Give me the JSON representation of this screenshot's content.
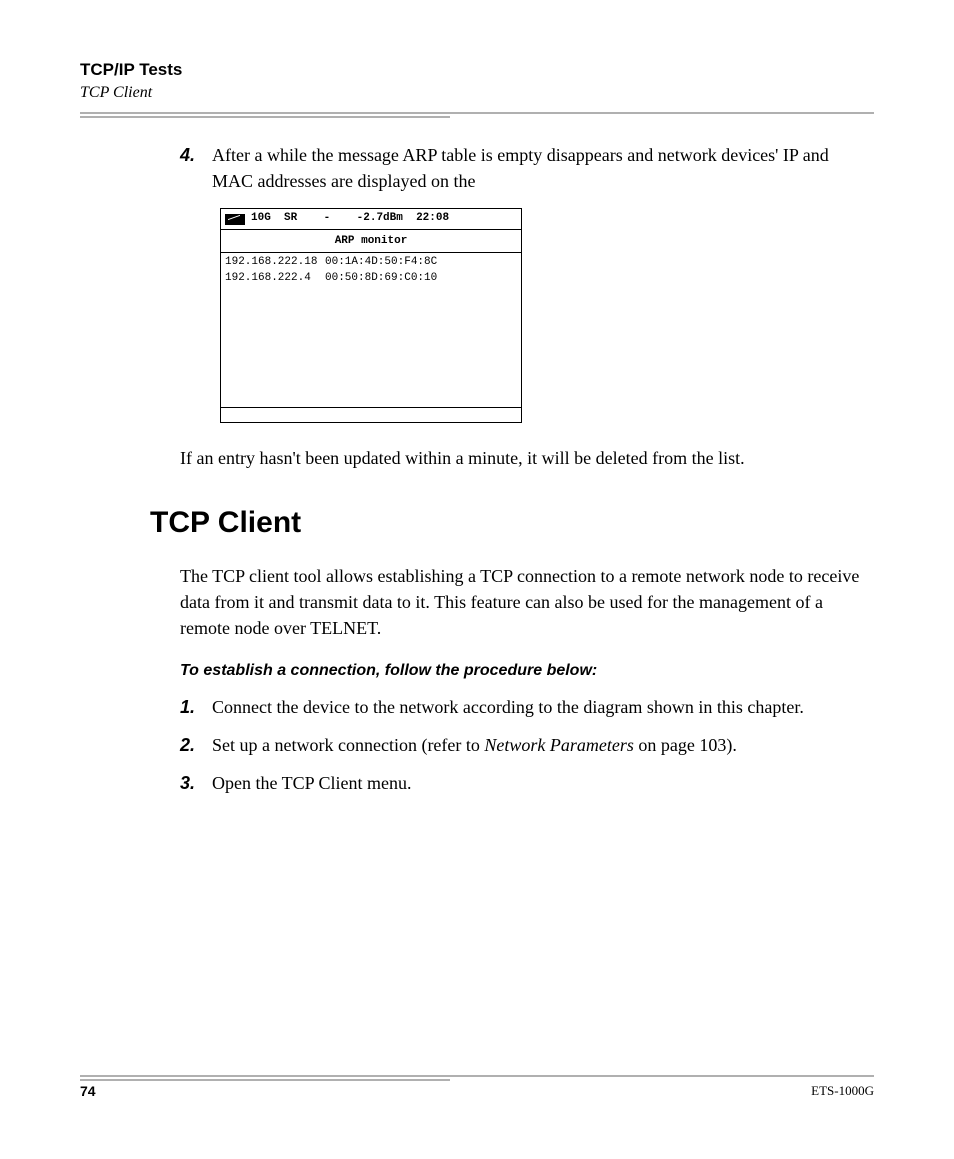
{
  "header": {
    "chapter": "TCP/IP Tests",
    "section": "TCP Client"
  },
  "step4": {
    "num": "4.",
    "text": "After a while the message ARP table is empty disappears and network devices' IP and MAC addresses are displayed on the"
  },
  "screenshot": {
    "top": {
      "speed": "10G",
      "mode": "SR",
      "dash": "-",
      "dbm": "-2.7dBm",
      "time": "22:08"
    },
    "title": "ARP monitor",
    "rows": [
      {
        "ip": "192.168.222.18",
        "mac": "00:1A:4D:50:F4:8C"
      },
      {
        "ip": "192.168.222.4",
        "mac": "00:50:8D:69:C0:10"
      }
    ]
  },
  "after_screenshot_para": "If an entry hasn't been updated within a minute, it will be deleted from the list.",
  "heading2": "TCP Client",
  "tcp_intro": "The TCP client tool allows establishing a TCP connection to a remote network node to receive data from it and transmit data to it. This feature can also be used for the management of a remote node over TELNET.",
  "procedure_label": "To establish a connection, follow the procedure below:",
  "steps": [
    {
      "num": "1.",
      "text": "Connect the device to the network according to the diagram shown in this chapter."
    },
    {
      "num": "2.",
      "text_pre": "Set up a network connection (refer to ",
      "ref": "Network Parameters",
      "text_post": " on page 103)."
    },
    {
      "num": "3.",
      "text": "Open the TCP Client menu."
    }
  ],
  "footer": {
    "page": "74",
    "model": "ETS-1000G"
  }
}
